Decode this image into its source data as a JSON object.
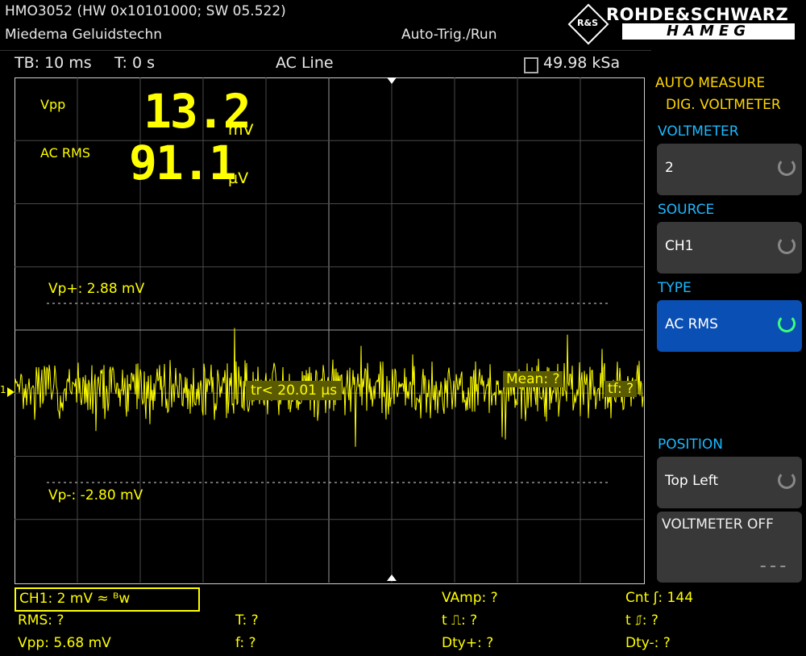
{
  "header": {
    "model_line": "HMO3052 (HW 0x10101000; SW 05.522)",
    "owner": "Miedema Geluidstechn",
    "trigger_mode": "Auto-Trig./Run",
    "brand_top": "ROHDE&SCHWARZ",
    "brand_bottom": "HAMEG",
    "brand_emblem": "R&S"
  },
  "status": {
    "timebase": "TB: 10 ms",
    "trigger_time": "T: 0 s",
    "trigger_source": "AC Line",
    "sample_rate": "49.98 kSa"
  },
  "voltmeter": {
    "label1": "Vpp",
    "value1": "13.2",
    "unit1": "mV",
    "label2": "AC RMS",
    "value2": "91.1",
    "unit2": "µV"
  },
  "cursors": {
    "vp_plus": "Vp+: 2.88 mV",
    "vp_minus": "Vp-: -2.80 mV",
    "rise": "tr< 20.01 µs",
    "mean": "Mean: ?",
    "fall": "tf: ?",
    "ch_marker": "1"
  },
  "menu": {
    "title1": "AUTO MEASURE",
    "title2": "DIG. VOLTMETER",
    "items": [
      {
        "heading": "VOLTMETER",
        "value": "2",
        "selected": false
      },
      {
        "heading": "SOURCE",
        "value": "CH1",
        "selected": false
      },
      {
        "heading": "TYPE",
        "value": "AC RMS",
        "selected": true
      },
      {
        "heading": "POSITION",
        "value": "Top Left",
        "selected": false
      }
    ],
    "off_label": "VOLTMETER OFF",
    "off_value": "– – –"
  },
  "bottom": {
    "ch1": "CH1: 2 mV ≈ ᴮw",
    "vamp": "VAmp: ?",
    "cnt": "Cnt ʃ: 144",
    "rms": "RMS: ?",
    "t": "T: ?",
    "tpos": "t ⎍: ?",
    "tneg": "t ⎎: ?",
    "vpp": "Vpp: 5.68 mV",
    "f": "f: ?",
    "dty_pos": "Dty+: ?",
    "dty_neg": "Dty-: ?"
  },
  "colors": {
    "trace": "#ffff00",
    "menu_heading": "#1bb9ff",
    "selected_button": "#0a4fb4",
    "indicator_active": "#3cff78"
  }
}
